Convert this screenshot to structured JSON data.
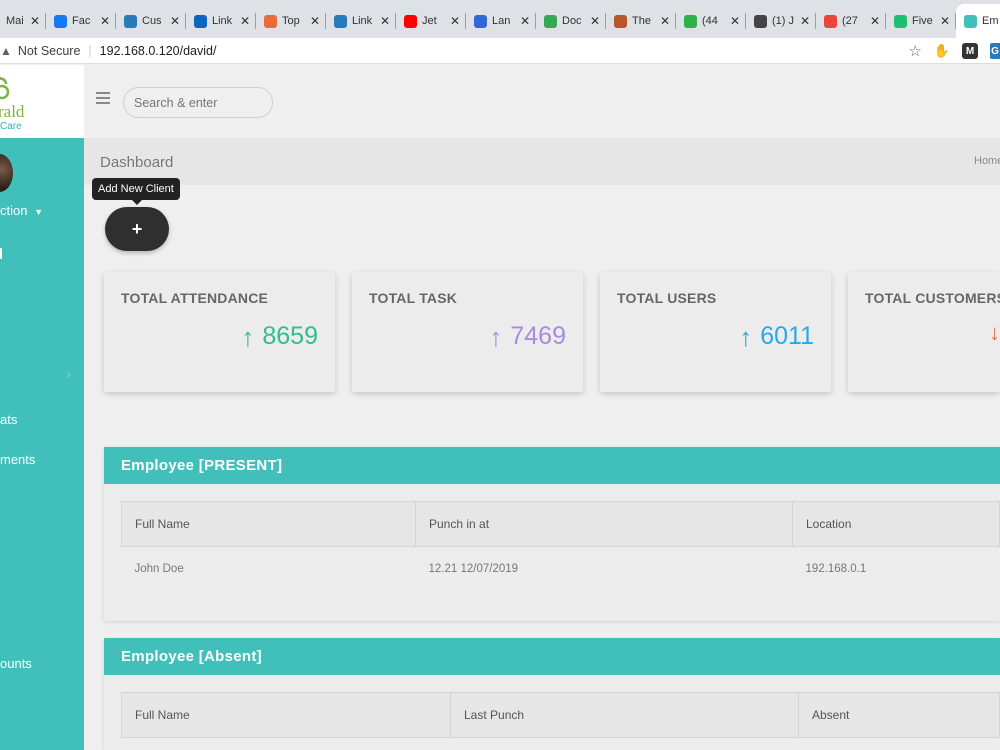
{
  "browser": {
    "tabs": [
      {
        "title": "Mai",
        "icon": "mail-icon",
        "color": "#ea4335"
      },
      {
        "title": "Fac",
        "icon": "facebook-icon",
        "color": "#1877f2"
      },
      {
        "title": "Cus",
        "icon": "cus-icon",
        "color": "#2a7ab8"
      },
      {
        "title": "Link",
        "icon": "linkedin-icon",
        "color": "#0a66c2"
      },
      {
        "title": "Top",
        "icon": "b-icon",
        "color": "#e86b3a"
      },
      {
        "title": "Link",
        "icon": "link-icon",
        "color": "#2a7ab8"
      },
      {
        "title": "Jet",
        "icon": "youtube-icon",
        "color": "#ff0000"
      },
      {
        "title": "Lan",
        "icon": "target-icon",
        "color": "#3367d6"
      },
      {
        "title": "Doc",
        "icon": "doc-icon",
        "color": "#34a853"
      },
      {
        "title": "The",
        "icon": "person-icon",
        "color": "#b5562b"
      },
      {
        "title": "(44",
        "icon": "chat-icon",
        "color": "#2bb34a"
      },
      {
        "title": "(1) J",
        "icon": "square-icon",
        "color": "#444444"
      },
      {
        "title": "(27",
        "icon": "flag-icon",
        "color": "#e8453c"
      },
      {
        "title": "Five",
        "icon": "five-icon",
        "color": "#1dbf73"
      },
      {
        "title": "Em",
        "icon": "emerald-icon",
        "color": "#40bfbb"
      }
    ],
    "security_label": "Not Secure",
    "url": "192.168.0.120/david/"
  },
  "brand": {
    "name": "rald",
    "sub": "Care"
  },
  "sidebar": {
    "section_label": "ction",
    "items": [
      "ats",
      "ments",
      "ounts"
    ]
  },
  "topbar": {
    "search_placeholder": "Search & enter"
  },
  "header": {
    "title": "Dashboard",
    "breadcrumb_home": "Home"
  },
  "add_client": {
    "tooltip": "Add New Client",
    "button_label": "+"
  },
  "stats": [
    {
      "label": "TOTAL ATTENDANCE",
      "value": "8659",
      "color": "#2fbf8c",
      "arrow": "↑"
    },
    {
      "label": "TOTAL TASK",
      "value": "7469",
      "color": "#a88be0",
      "arrow": "↑"
    },
    {
      "label": "TOTAL USERS",
      "value": "6011",
      "color": "#2aa8e6",
      "arrow": "↑"
    },
    {
      "label": "TOTAL CUSTOMERS",
      "value": "",
      "color": "#e8704a",
      "arrow": "↓"
    }
  ],
  "present_panel": {
    "title": "Employee [PRESENT]",
    "columns": [
      "Full Name",
      "Punch in at",
      "Location"
    ],
    "rows": [
      [
        "John Doe",
        "12.21 12/07/2019",
        "192.168.0.1"
      ]
    ]
  },
  "absent_panel": {
    "title": "Employee [Absent]",
    "columns": [
      "Full Name",
      "Last Punch",
      "Absent"
    ]
  }
}
